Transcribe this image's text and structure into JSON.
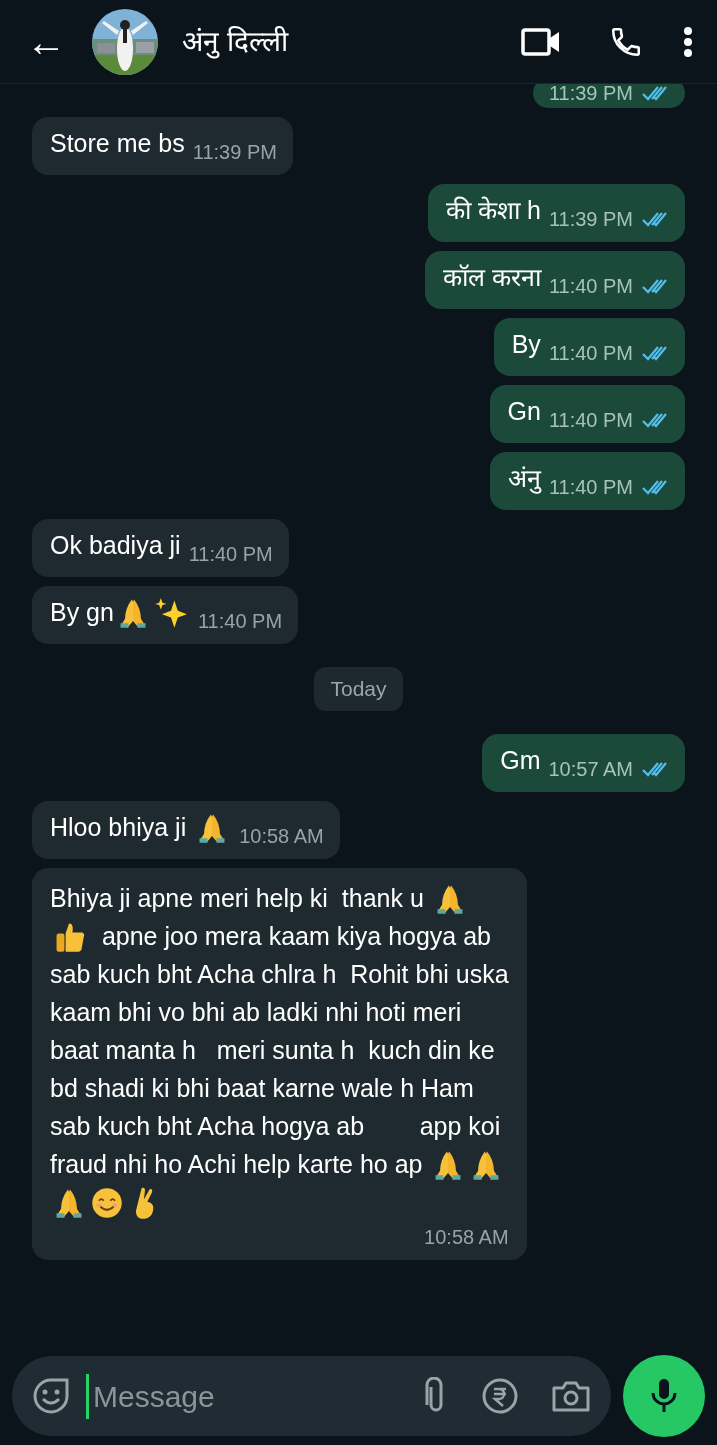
{
  "header": {
    "back": "←",
    "contact_name": "अंनु दिल्ली"
  },
  "messages": [
    {
      "kind": "message",
      "outgoing": true,
      "read": true,
      "time": "11:39 PM"
    },
    {
      "kind": "message",
      "outgoing": false,
      "lines": [
        [
          {
            "kind": "text",
            "text": "Store me bs"
          }
        ]
      ],
      "time": "11:39 PM"
    },
    {
      "kind": "message",
      "outgoing": true,
      "read": true,
      "lines": [
        [
          {
            "kind": "text",
            "text": "की केशा h"
          }
        ]
      ],
      "time": "11:39 PM"
    },
    {
      "kind": "message",
      "outgoing": true,
      "read": true,
      "lines": [
        [
          {
            "kind": "text",
            "text": "कॉल करना"
          }
        ]
      ],
      "time": "11:40 PM"
    },
    {
      "kind": "message",
      "outgoing": true,
      "read": true,
      "lines": [
        [
          {
            "kind": "text",
            "text": "By"
          }
        ]
      ],
      "time": "11:40 PM"
    },
    {
      "kind": "message",
      "outgoing": true,
      "read": true,
      "lines": [
        [
          {
            "kind": "text",
            "text": "Gn"
          }
        ]
      ],
      "time": "11:40 PM"
    },
    {
      "kind": "message",
      "outgoing": true,
      "read": true,
      "lines": [
        [
          {
            "kind": "text",
            "text": "अंनु"
          }
        ]
      ],
      "time": "11:40 PM"
    },
    {
      "kind": "message",
      "outgoing": false,
      "lines": [
        [
          {
            "kind": "text",
            "text": "Ok badiya ji"
          }
        ]
      ],
      "time": "11:40 PM"
    },
    {
      "kind": "message",
      "outgoing": false,
      "lines": [
        [
          {
            "kind": "text",
            "text": "By gn"
          },
          {
            "kind": "pray"
          },
          {
            "kind": "sparkles"
          }
        ]
      ],
      "time": "11:40 PM"
    },
    {
      "kind": "date",
      "label": "Today"
    },
    {
      "kind": "message",
      "outgoing": true,
      "read": true,
      "lines": [
        [
          {
            "kind": "text",
            "text": "Gm"
          }
        ]
      ],
      "time": "10:57 AM"
    },
    {
      "kind": "message",
      "outgoing": false,
      "lines": [
        [
          {
            "kind": "text",
            "text": "Hloo bhiya ji "
          },
          {
            "kind": "pray"
          }
        ]
      ],
      "time": "10:58 AM"
    },
    {
      "kind": "long-message",
      "outgoing": false,
      "lines": [
        [
          {
            "kind": "text",
            "text": "Bhiya ji apne meri help ki  thank u "
          },
          {
            "kind": "pray"
          }
        ],
        [
          {
            "kind": "thumbs-up"
          },
          {
            "kind": "text",
            "text": "  apne joo mera kaam kiya hogya ab"
          }
        ],
        [
          {
            "kind": "text",
            "text": "sab kuch bht Acha chlra h  Rohit bhi uska"
          }
        ],
        [
          {
            "kind": "text",
            "text": "kaam bhi vo bhi ab ladki nhi hoti meri"
          }
        ],
        [
          {
            "kind": "text",
            "text": "baat manta h   meri sunta h  kuch din ke"
          }
        ],
        [
          {
            "kind": "text",
            "text": "bd shadi ki bhi baat karne wale h Ham"
          }
        ],
        [
          {
            "kind": "text",
            "text": "sab kuch bht Acha hogya ab        app koi"
          }
        ],
        [
          {
            "kind": "text",
            "text": "fraud nhi ho Achi help karte ho ap "
          },
          {
            "kind": "pray"
          },
          {
            "kind": "pray"
          }
        ],
        [
          {
            "kind": "pray"
          },
          {
            "kind": "smile"
          },
          {
            "kind": "crossed-fingers"
          }
        ]
      ],
      "time": "10:58 AM"
    }
  ],
  "composer": {
    "placeholder": "Message"
  }
}
